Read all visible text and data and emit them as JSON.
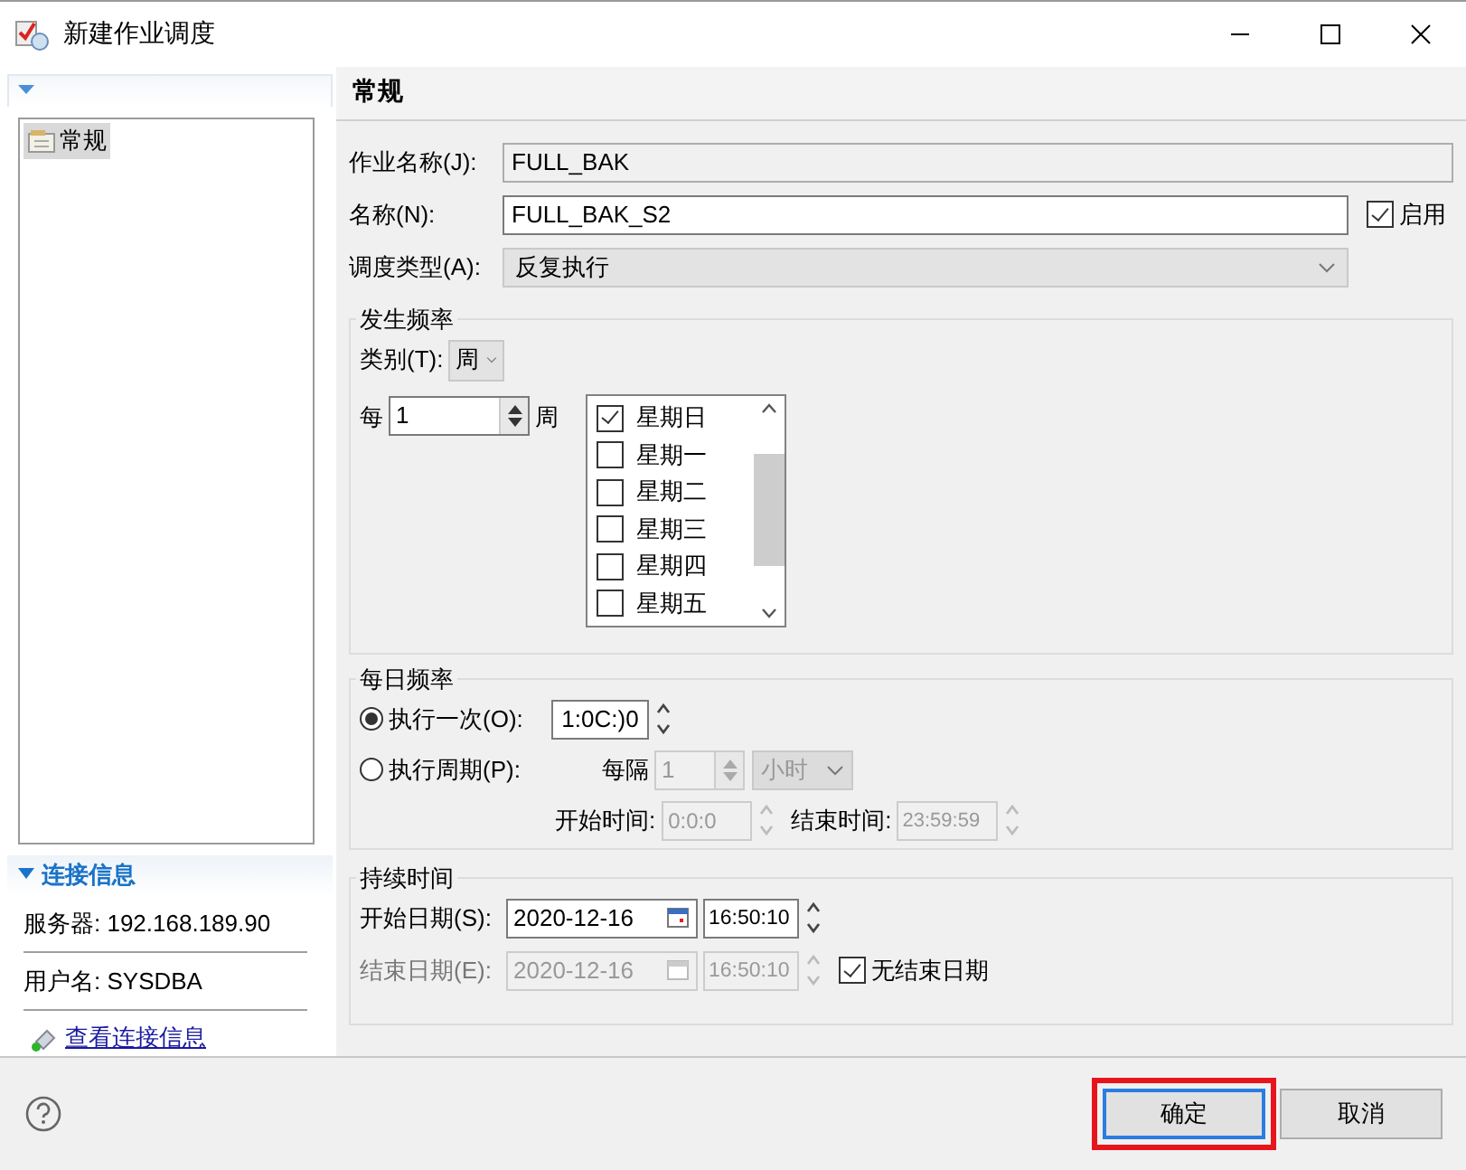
{
  "window": {
    "title": "新建作业调度"
  },
  "sidebar": {
    "items": [
      {
        "label": "常规",
        "selected": true
      }
    ],
    "connection": {
      "title": "连接信息",
      "expanded": true,
      "server": "服务器: 192.168.189.90",
      "user": "用户名: SYSDBA",
      "link": "查看连接信息"
    }
  },
  "form": {
    "title": "常规",
    "job_name": {
      "label": "作业名称(J):",
      "value": "FULL_BAK",
      "disabled": true
    },
    "name": {
      "label": "名称(N):",
      "value": "FULL_BAK_S2",
      "disabled": false
    },
    "enabled": {
      "label": "启用",
      "checked": true
    },
    "schedule_type": {
      "label": "调度类型(A):",
      "value": "反复执行"
    },
    "occurrence": {
      "title": "发生频率",
      "category_label": "类别(T):",
      "category": "周",
      "every_label": "每",
      "every_value": "1",
      "unit": "周",
      "days": [
        {
          "label": "星期日",
          "checked": true
        },
        {
          "label": "星期一",
          "checked": false
        },
        {
          "label": "星期二",
          "checked": false
        },
        {
          "label": "星期三",
          "checked": false
        },
        {
          "label": "星期四",
          "checked": false
        },
        {
          "label": "星期五",
          "checked": false
        }
      ]
    },
    "daily": {
      "title": "每日频率",
      "once": {
        "label": "执行一次(O):",
        "selected": true,
        "value": "1:0C:)0"
      },
      "periodic": {
        "label": "执行周期(P):",
        "selected": false,
        "every_label": "每隔",
        "every_value": "1",
        "unit": "小时",
        "start_label": "开始时间:",
        "start": "0:0:0",
        "end_label": "结束时间:",
        "end": "23:59:59"
      }
    },
    "duration": {
      "title": "持续时间",
      "start": {
        "label": "开始日期(S):",
        "date": "2020-12-16",
        "time": "16:50:10",
        "disabled": false
      },
      "end": {
        "label": "结束日期(E):",
        "date": "2020-12-16",
        "time": "16:50:10",
        "disabled": true
      },
      "no_end": {
        "label": "无结束日期",
        "checked": true
      }
    }
  },
  "buttons": [
    {
      "label": "确定",
      "highlighted": true
    },
    {
      "label": "取消",
      "highlighted": false
    }
  ]
}
